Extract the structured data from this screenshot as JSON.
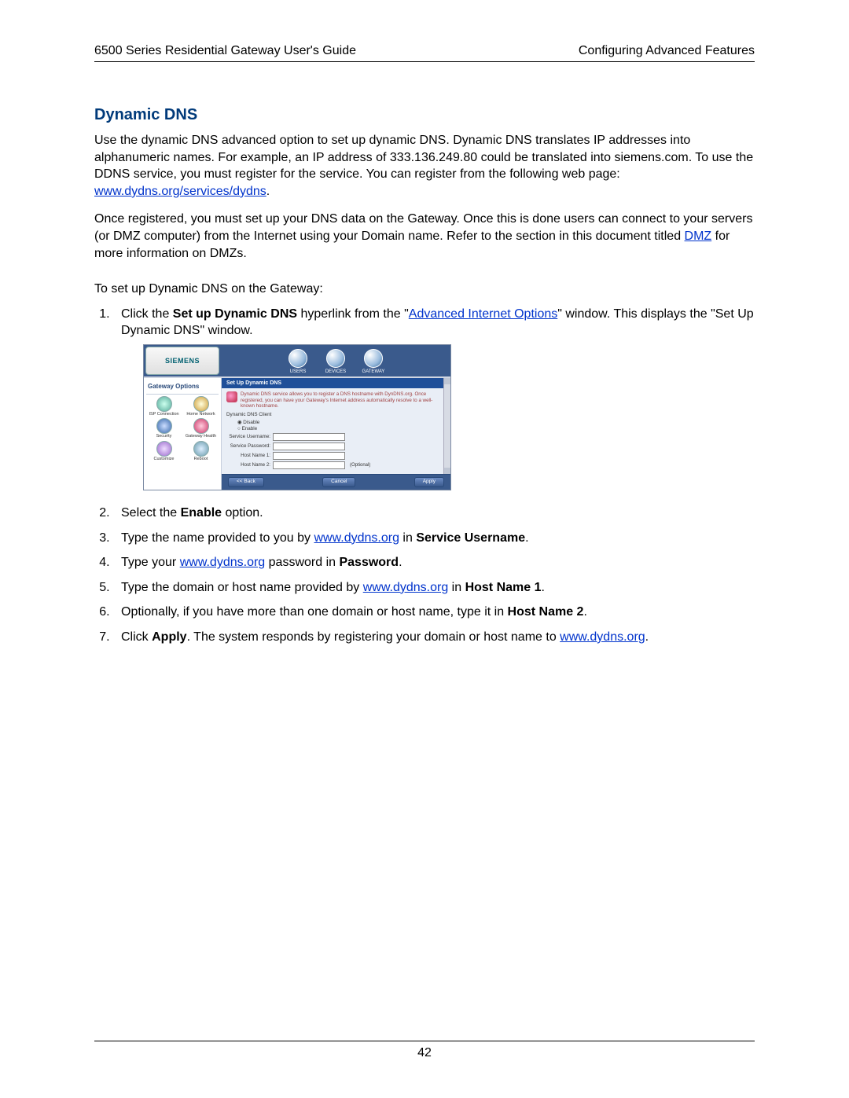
{
  "header": {
    "left": "6500 Series Residential Gateway User's Guide",
    "right": "Configuring Advanced Features"
  },
  "section_title": "Dynamic DNS",
  "para1_a": "Use the dynamic DNS advanced option to set up dynamic DNS. Dynamic DNS translates IP addresses into alphanumeric names. For example, an IP address of 333.136.249.80 could be translated into siemens.com. To use the DDNS service, you must register for the service. You can register from the following web page: ",
  "para1_link": "www.dydns.org/services/dydns",
  "para1_b": ".",
  "para2_a": "Once registered, you must set up your DNS data on the Gateway. Once this is done users can connect to your servers (or DMZ computer) from the Internet using your Domain name. Refer to the section in this document titled ",
  "para2_link": "DMZ",
  "para2_b": " for more information on DMZs.",
  "steps_intro": "To set up Dynamic DNS on the Gateway:",
  "step1_a": "Click the ",
  "step1_bold": "Set up Dynamic DNS",
  "step1_b": " hyperlink from the \"",
  "step1_link": "Advanced Internet Options",
  "step1_c": "\" window. This displays the \"Set Up Dynamic DNS\" window.",
  "step2_a": "Select the ",
  "step2_bold": "Enable",
  "step2_b": " option.",
  "step3_a": "Type the name provided to you by ",
  "step3_link": "www.dydns.org",
  "step3_b": " in ",
  "step3_bold": "Service Username",
  "step3_c": ".",
  "step4_a": "Type your ",
  "step4_link": "www.dydns.org",
  "step4_b": " password in ",
  "step4_bold": "Password",
  "step4_c": ".",
  "step5_a": "Type the domain or host name provided by ",
  "step5_link": "www.dydns.org",
  "step5_b": " in ",
  "step5_bold": "Host Name 1",
  "step5_c": ".",
  "step6_a": "Optionally, if you have more than one domain or host name, type it in ",
  "step6_bold": "Host Name 2",
  "step6_b": ".",
  "step7_a": "Click ",
  "step7_bold": "Apply",
  "step7_b": ". The system responds by registering your domain or host name to ",
  "step7_link": "www.dydns.org",
  "step7_c": ".",
  "page_number": "42",
  "shot": {
    "logo": "SIEMENS",
    "tabs": [
      "USERS",
      "DEVICES",
      "GATEWAY"
    ],
    "side_title": "Gateway Options",
    "side_items": [
      "ISP Connection",
      "Home Network",
      "Security",
      "Gateway Health",
      "Customize",
      "Reboot"
    ],
    "bluebar": "Set Up Dynamic DNS",
    "desc": "Dynamic DNS service allows you to register a DNS hostname with DynDNS.org. Once registered, you can have your Gateway's Internet address automatically resolve to a well-known hostname.",
    "form_title": "Dynamic DNS Client",
    "radio_disable": "Disable",
    "radio_enable": "Enable",
    "labels": [
      "Service Username:",
      "Service Password:",
      "Host Name 1:",
      "Host Name 2:"
    ],
    "optional": "(Optional)",
    "btn_back": "<< Back",
    "btn_cancel": "Cancel",
    "btn_apply": "Apply"
  }
}
